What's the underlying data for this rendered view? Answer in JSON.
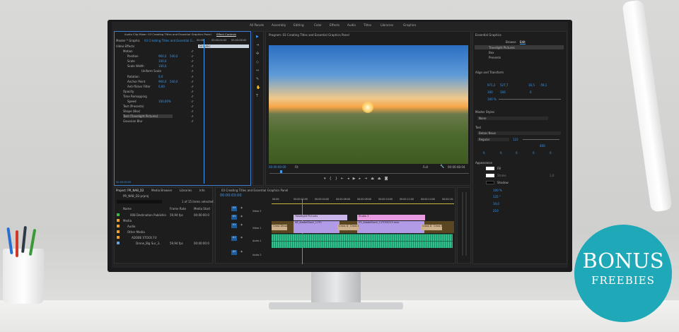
{
  "workspaces": [
    "All Panels",
    "Assembly",
    "Editing",
    "Color",
    "Effects",
    "Audio",
    "Titles",
    "Libraries",
    "Graphics"
  ],
  "active_workspace": "Graphics",
  "effect_controls": {
    "tabs": [
      "Audio Clip Mixer: 03 Creating Titles and Essential Graphics Panel",
      "Effect Controls"
    ],
    "master": "Master * Graphic",
    "sequence": "03 Creating Titles and Essential G...",
    "section": "Video Effects",
    "timecodes": [
      "00:00",
      "00:00:04:00",
      "00:00:08:00"
    ],
    "clip_label": "Graphic",
    "rows": [
      {
        "label": "Motion",
        "v1": "",
        "v2": ""
      },
      {
        "label": "Position",
        "v1": "960,0",
        "v2": "540,0"
      },
      {
        "label": "Scale",
        "v1": "100,0",
        "v2": ""
      },
      {
        "label": "Scale Width",
        "v1": "100,0",
        "v2": ""
      },
      {
        "label": "Uniform Scale",
        "v1": "",
        "v2": ""
      },
      {
        "label": "Rotation",
        "v1": "0,0",
        "v2": ""
      },
      {
        "label": "Anchor Point",
        "v1": "960,0",
        "v2": "540,0"
      },
      {
        "label": "Anti-flicker Filter",
        "v1": "0,00",
        "v2": ""
      },
      {
        "label": "Opacity",
        "v1": "",
        "v2": ""
      },
      {
        "label": "Time Remapping",
        "v1": "",
        "v2": ""
      },
      {
        "label": "Speed",
        "v1": "100,00%",
        "v2": ""
      },
      {
        "label": "Text (Presents)",
        "v1": "",
        "v2": ""
      },
      {
        "label": "Shape (Box)",
        "v1": "",
        "v2": ""
      },
      {
        "label": "Text (Travelight Pictures)",
        "v1": "",
        "v2": ""
      },
      {
        "label": "Gaussian Blur",
        "v1": "",
        "v2": ""
      }
    ],
    "bottom_timecode": "00:00:00:00"
  },
  "program": {
    "title": "Program: 03 Creating Titles and Essential Graphics Panel",
    "timecode": "00:00:00:00",
    "fit": "Fit",
    "quality": "Full",
    "duration": "00:00:48:04"
  },
  "essential_graphics": {
    "title": "Essential Graphics",
    "tabs": [
      "Browse",
      "Edit"
    ],
    "active_tab": "Edit",
    "layers": [
      "Travelight Pictures",
      "Box",
      "Presents"
    ],
    "align_title": "Align and Transform",
    "position": [
      "971,2",
      "527,7"
    ],
    "anchor": [
      "16,5",
      "-59,1"
    ],
    "scale": "100",
    "scale2": "100",
    "rotation": "0",
    "opacity": "100 %",
    "master_styles_title": "Master Styles",
    "master_style": "None",
    "text_title": "Text",
    "font": "Bebas Neue",
    "font_style": "Regular",
    "font_size": "122",
    "tracking_vals": [
      "400",
      "0",
      "0",
      "0",
      "0",
      "0"
    ],
    "appearance_title": "Appearance",
    "fill": "Fill",
    "stroke": "Stroke",
    "stroke_width": "1,0",
    "shadow": "Shadow",
    "shadow_opacity": "100 %",
    "shadow_angle": "135 °",
    "shadow_distance": "10,0",
    "shadow_size": "210"
  },
  "project": {
    "tabs": [
      "Project: PR_NAB_D2",
      "Media Browser",
      "Libraries",
      "Info"
    ],
    "file": "PR_NAB_D2.prproj",
    "selected": "1 of 15 items selected",
    "columns": [
      "Name",
      "Frame Rate",
      "Media Start"
    ],
    "items": [
      {
        "name": "008 Destination Publishin",
        "rate": "59,94 fps",
        "start": "00:00:00:0",
        "color": "#3fb54a"
      },
      {
        "name": "Media",
        "rate": "",
        "start": "",
        "color": "#f0a030"
      },
      {
        "name": "Audio",
        "rate": "",
        "start": "",
        "color": "#f0a030"
      },
      {
        "name": "Other Media",
        "rate": "",
        "start": "",
        "color": "#f0a030"
      },
      {
        "name": "ADOBE STOCK FU",
        "rate": "",
        "start": "",
        "color": "#f0a030"
      },
      {
        "name": "Drone_Big Sur_3..",
        "rate": "59,94 fps",
        "start": "00:00:00:0",
        "color": "#6aa0d8"
      }
    ]
  },
  "timeline": {
    "title": "03 Creating Titles and Essential Graphics Panel",
    "timecode": "00:00:03:00",
    "ruler": [
      "00:00",
      "00:00:02:00",
      "00:00:04:00",
      "00:00:06:00",
      "00:00:08:00",
      "00:00:10:00",
      "00:00:12:00",
      "00:00:14:00",
      "00:00:16:"
    ],
    "tracks": [
      {
        "id": "V3",
        "name": "Video 3"
      },
      {
        "id": "V2",
        "name": ""
      },
      {
        "id": "V1",
        "name": "Video 1"
      },
      {
        "id": "A1",
        "name": "Audio 1"
      },
      {
        "id": "A2",
        "name": "Audio 2"
      }
    ],
    "clips_v2": [
      "Travelight Pictures",
      "Studio 2"
    ],
    "clips_v1": [
      "Cross Dissolve",
      "06_AdobeStock_1170",
      "Cross D",
      "Cross D",
      "03_AdobeStock_117050215.mov",
      "Cross D",
      "Cross D"
    ]
  },
  "promo": {
    "line1": "BONUS",
    "line2": "FREEBIES",
    "color": "#1fa9b8"
  }
}
